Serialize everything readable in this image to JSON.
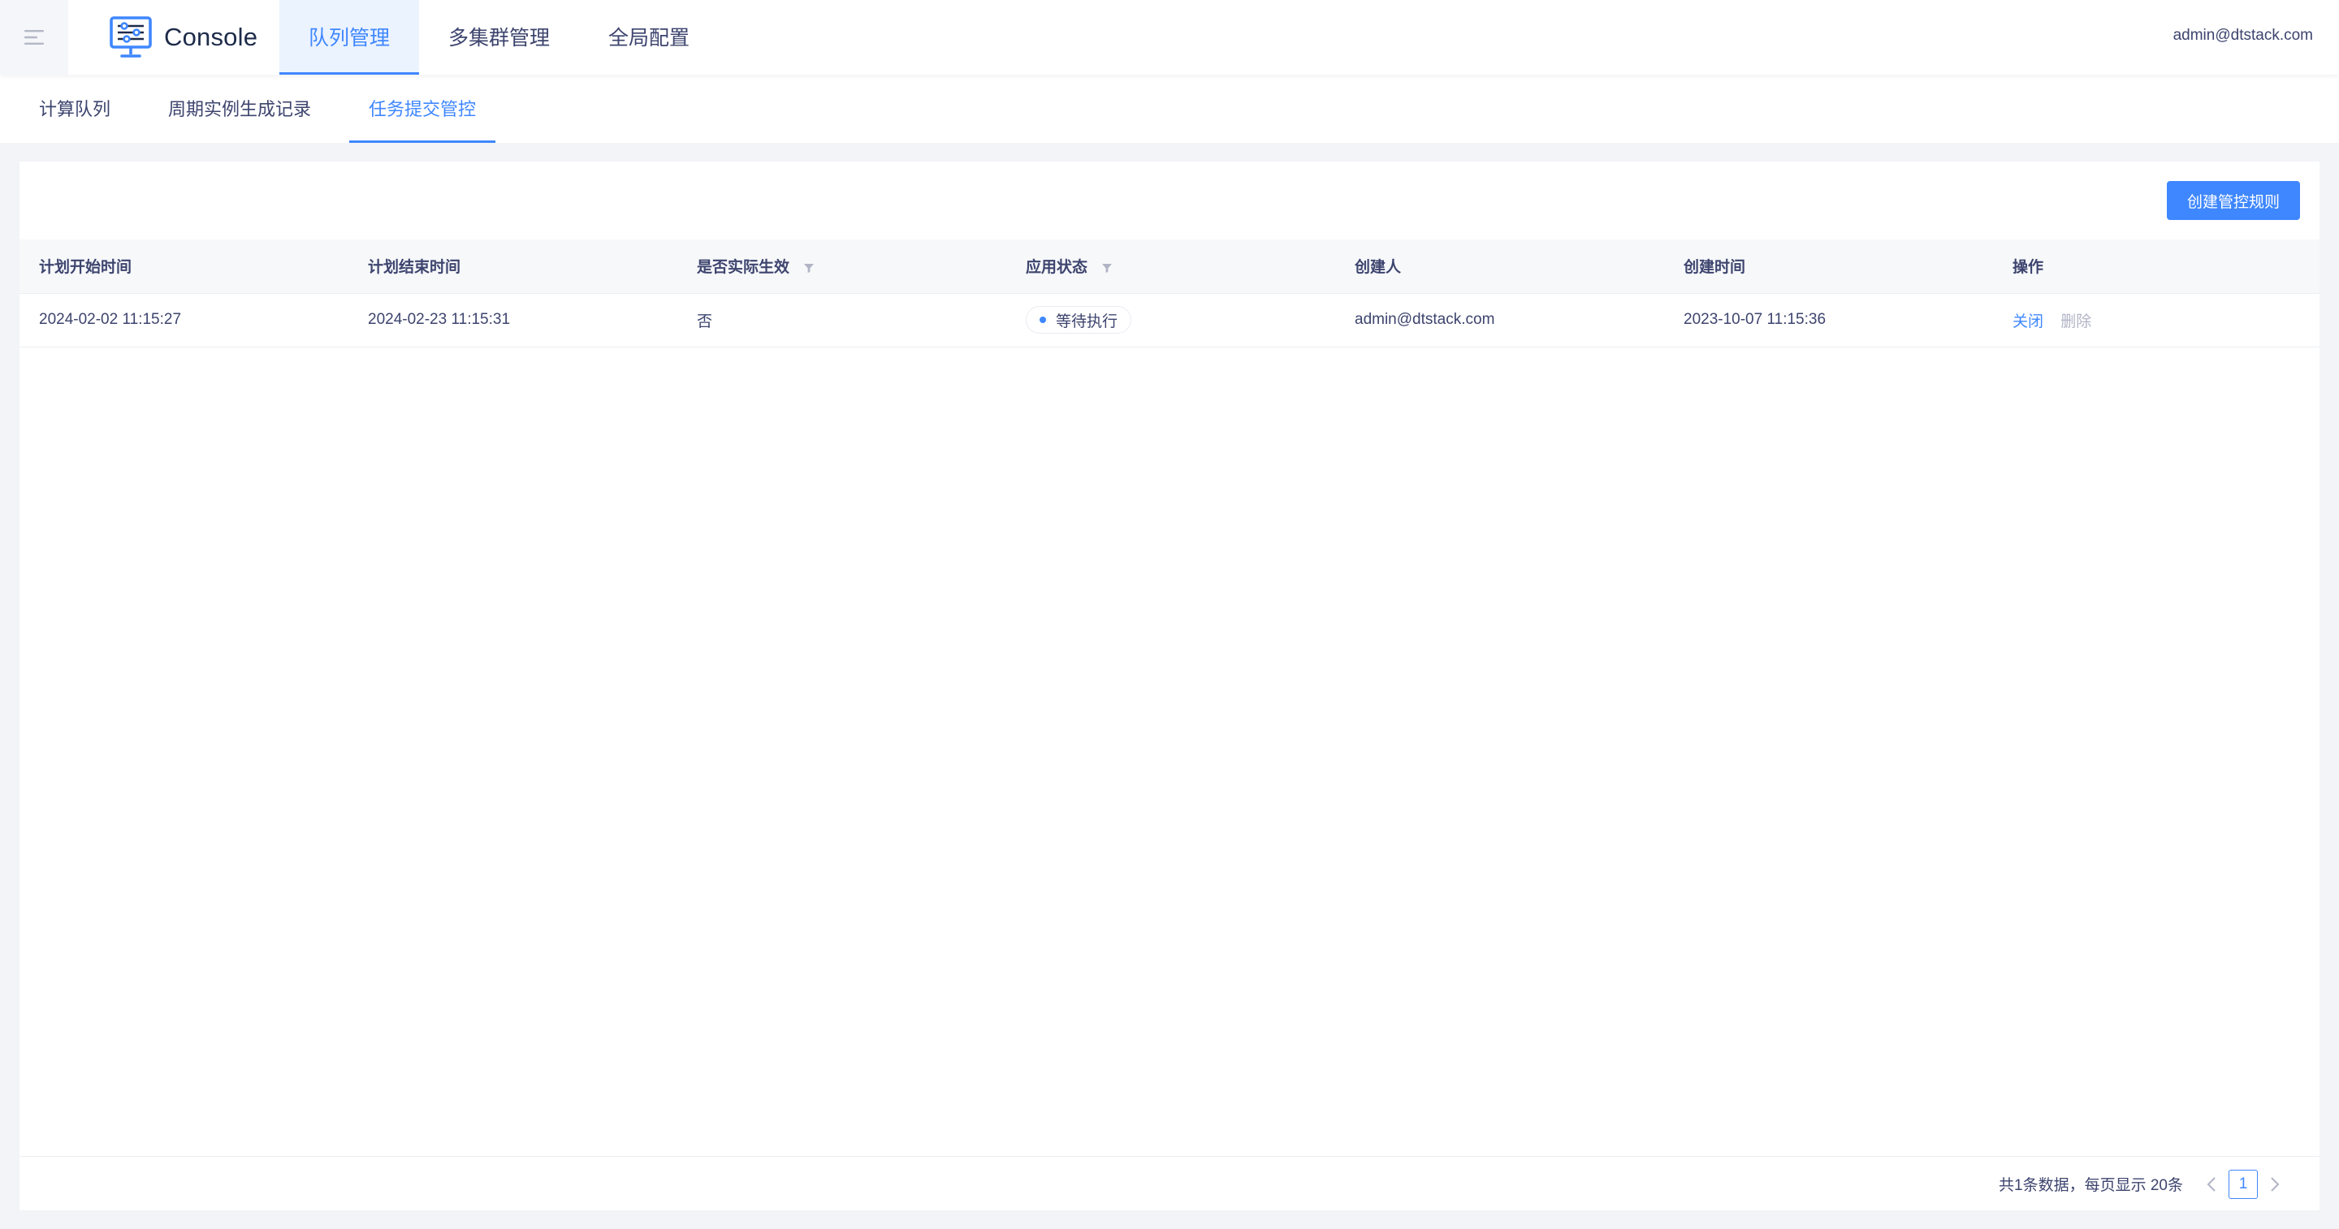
{
  "header": {
    "logo_text": "Console",
    "nav": [
      {
        "label": "队列管理",
        "active": true
      },
      {
        "label": "多集群管理",
        "active": false
      },
      {
        "label": "全局配置",
        "active": false
      }
    ],
    "user": "admin@dtstack.com"
  },
  "subtabs": [
    {
      "label": "计算队列",
      "active": false
    },
    {
      "label": "周期实例生成记录",
      "active": false
    },
    {
      "label": "任务提交管控",
      "active": true
    }
  ],
  "toolbar": {
    "create_label": "创建管控规则"
  },
  "table": {
    "columns": [
      "计划开始时间",
      "计划结束时间",
      "是否实际生效",
      "应用状态",
      "创建人",
      "创建时间",
      "操作"
    ],
    "rows": [
      {
        "start": "2024-02-02 11:15:27",
        "end": "2024-02-23 11:15:31",
        "effective": "否",
        "status": "等待执行",
        "creator": "admin@dtstack.com",
        "created": "2023-10-07 11:15:36",
        "actions": {
          "close": "关闭",
          "delete": "删除"
        }
      }
    ]
  },
  "pagination": {
    "summary": "共1条数据，每页显示 20条",
    "current_page": "1"
  },
  "colors": {
    "primary": "#3f87ff",
    "text": "#3d446e",
    "disabled": "#b1b4c5",
    "nav_active_bg": "#ebf3ff"
  },
  "icons": {
    "menu": "menu-fold-icon",
    "logo": "monitor-settings-icon",
    "filter": "filter-icon",
    "prev": "chevron-left-icon",
    "next": "chevron-right-icon"
  }
}
